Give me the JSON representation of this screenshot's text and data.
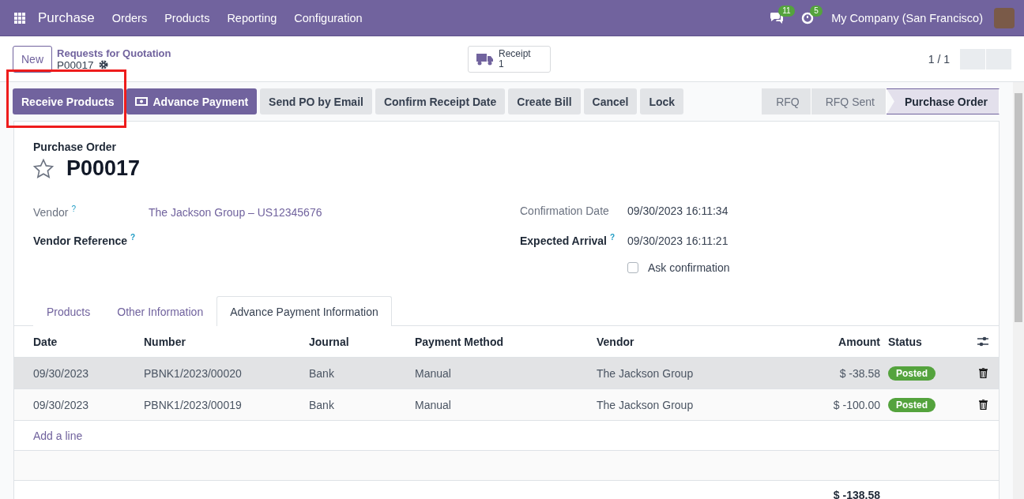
{
  "navbar": {
    "app": "Purchase",
    "menus": [
      "Orders",
      "Products",
      "Reporting",
      "Configuration"
    ],
    "messages_count": "11",
    "activities_count": "5",
    "company": "My Company (San Francisco)"
  },
  "control_panel": {
    "new_button": "New",
    "breadcrumb": "Requests for Quotation",
    "record": "P00017",
    "smart_button": {
      "label": "Receipt",
      "count": "1"
    },
    "pager": "1 / 1"
  },
  "actions": [
    {
      "label": "Receive Products",
      "kind": "primary",
      "highlighted": true
    },
    {
      "label": "Advance Payment",
      "kind": "primary",
      "highlighted": false
    },
    {
      "label": "Send PO by Email",
      "kind": "secondary",
      "highlighted": false
    },
    {
      "label": "Confirm Receipt Date",
      "kind": "secondary",
      "highlighted": false
    },
    {
      "label": "Create Bill",
      "kind": "secondary",
      "highlighted": false
    },
    {
      "label": "Cancel",
      "kind": "secondary",
      "highlighted": false
    },
    {
      "label": "Lock",
      "kind": "secondary",
      "highlighted": false
    }
  ],
  "stages": [
    {
      "label": "RFQ",
      "selected": false
    },
    {
      "label": "RFQ Sent",
      "selected": false
    },
    {
      "label": "Purchase Order",
      "selected": true
    }
  ],
  "sheet": {
    "subtitle": "Purchase Order",
    "title": "P00017",
    "starred": false,
    "left_fields": [
      {
        "label": "Vendor",
        "help": "?",
        "value": "The Jackson Group – US12345676",
        "bold": false
      },
      {
        "label": "Vendor Reference",
        "help": "?",
        "bold": true
      }
    ],
    "right_fields": [
      {
        "label": "Confirmation Date",
        "value": "09/30/2023 16:11:34",
        "bold": false
      },
      {
        "label": "Expected Arrival",
        "help": "?",
        "value": "09/30/2023 16:11:21",
        "bold": true
      }
    ],
    "ask_confirmation": {
      "label": "Ask confirmation",
      "checked": false
    },
    "tabs": [
      {
        "label": "Products",
        "selected": false
      },
      {
        "label": "Other Information",
        "selected": false
      },
      {
        "label": "Advance Payment Information",
        "selected": true
      }
    ],
    "table": {
      "columns": [
        "Date",
        "Number",
        "Journal",
        "Payment Method",
        "Vendor",
        "Amount",
        "Status"
      ],
      "rows": [
        {
          "date": "09/30/2023",
          "number": "PBNK1/2023/00020",
          "journal": "Bank",
          "method": "Manual",
          "vendor": "The Jackson Group",
          "amount": "$ -38.58",
          "status": "Posted",
          "selected": true
        },
        {
          "date": "09/30/2023",
          "number": "PBNK1/2023/00019",
          "journal": "Bank",
          "method": "Manual",
          "vendor": "The Jackson Group",
          "amount": "$ -100.00",
          "status": "Posted",
          "selected": false
        }
      ],
      "add_line": "Add a line",
      "total": "$ -138.58"
    }
  }
}
